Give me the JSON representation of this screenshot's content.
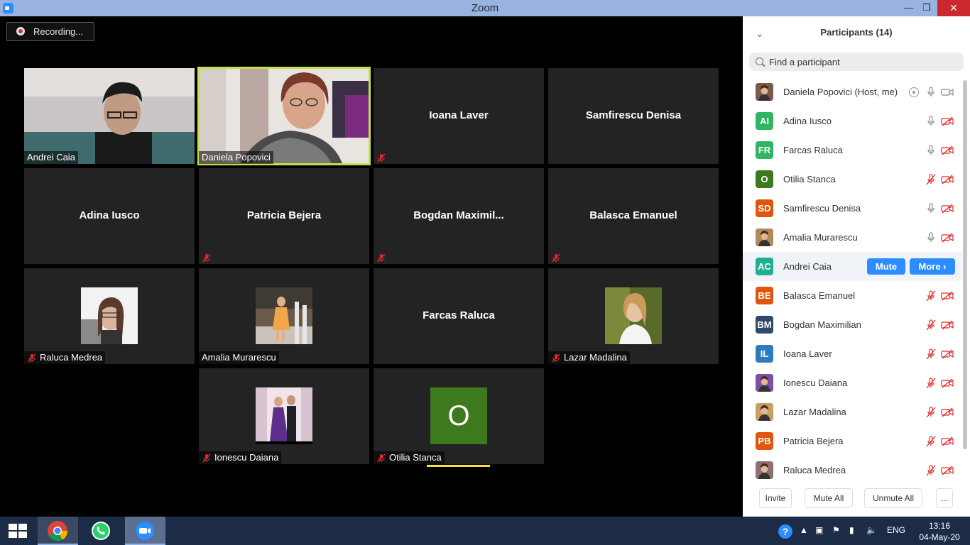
{
  "window": {
    "title": "Zoom"
  },
  "recording": {
    "label": "Recording..."
  },
  "tiles": [
    {
      "id": "andrei",
      "name": "Andrei Caia",
      "muted": false,
      "type": "video"
    },
    {
      "id": "daniela",
      "name": "Daniela Popovici",
      "muted": false,
      "type": "video",
      "active": true
    },
    {
      "id": "ioana",
      "name": "Ioana Laver",
      "muted": true,
      "type": "name"
    },
    {
      "id": "samfirescu",
      "name": "Samfirescu Denisa",
      "muted": false,
      "type": "name"
    },
    {
      "id": "adina",
      "name": "Adina Iusco",
      "muted": false,
      "type": "name"
    },
    {
      "id": "patricia",
      "name": "Patricia Bejera",
      "muted": true,
      "type": "name"
    },
    {
      "id": "bogdan",
      "name": "Bogdan  Maximil...",
      "muted": true,
      "type": "name"
    },
    {
      "id": "balasca",
      "name": "Balasca Emanuel",
      "muted": true,
      "type": "name"
    },
    {
      "id": "raluca",
      "name": "Raluca Medrea",
      "muted": true,
      "type": "photo"
    },
    {
      "id": "amalia",
      "name": "Amalia Murarescu",
      "muted": false,
      "type": "photo"
    },
    {
      "id": "farcas",
      "name": "Farcas Raluca",
      "muted": false,
      "type": "name"
    },
    {
      "id": "lazar",
      "name": "Lazar Madalina",
      "muted": true,
      "type": "photo"
    },
    {
      "id": "ionescu",
      "name": "Ionescu Daiana",
      "muted": true,
      "type": "photo"
    },
    {
      "id": "otilia",
      "name": "Otilia Stanca",
      "muted": true,
      "type": "letter",
      "letter": "O"
    }
  ],
  "panel": {
    "title": "Participants (14)",
    "search_placeholder": "Find a participant",
    "participants": [
      {
        "name": "Daniela Popovici (Host, me)",
        "initials": "",
        "color": "#7a5a4a",
        "mic": "on",
        "cam": "on",
        "photo": true,
        "recording": true
      },
      {
        "name": "Adina Iusco",
        "initials": "AI",
        "color": "#2fb563",
        "mic": "on",
        "cam": "off"
      },
      {
        "name": "Farcas Raluca",
        "initials": "FR",
        "color": "#2fb563",
        "mic": "on",
        "cam": "off"
      },
      {
        "name": "Otilia Stanca",
        "initials": "O",
        "color": "#3d7a1e",
        "mic": "off",
        "cam": "off"
      },
      {
        "name": "Samfirescu Denisa",
        "initials": "SD",
        "color": "#e0560e",
        "mic": "on",
        "cam": "off"
      },
      {
        "name": "Amalia Murarescu",
        "initials": "",
        "color": "#b08a5a",
        "mic": "on",
        "cam": "off",
        "photo": true
      },
      {
        "name": "Andrei Caia",
        "initials": "AC",
        "color": "#20b08f",
        "mic": "none",
        "cam": "none",
        "hover": true
      },
      {
        "name": "Balasca Emanuel",
        "initials": "BE",
        "color": "#e0560e",
        "mic": "off",
        "cam": "off"
      },
      {
        "name": "Bogdan Maximilian",
        "initials": "BM",
        "color": "#2e4a6b",
        "mic": "off",
        "cam": "off"
      },
      {
        "name": "Ioana Laver",
        "initials": "IL",
        "color": "#2d7cc0",
        "mic": "off",
        "cam": "off"
      },
      {
        "name": "Ionescu Daiana",
        "initials": "",
        "color": "#7b4fa3",
        "mic": "off",
        "cam": "off",
        "photo": true
      },
      {
        "name": "Lazar Madalina",
        "initials": "",
        "color": "#c9a060",
        "mic": "off",
        "cam": "off",
        "photo": true
      },
      {
        "name": "Patricia Bejera",
        "initials": "PB",
        "color": "#e0560e",
        "mic": "off",
        "cam": "off"
      },
      {
        "name": "Raluca Medrea",
        "initials": "",
        "color": "#8f7070",
        "mic": "off",
        "cam": "off",
        "photo": true
      }
    ],
    "mute_button": "Mute",
    "more_button": "More",
    "footer": {
      "invite": "Invite",
      "mute_all": "Mute All",
      "unmute_all": "Unmute All",
      "more": "..."
    }
  },
  "taskbar": {
    "language": "ENG",
    "time": "13:16",
    "date": "04-May-20"
  },
  "colors": {
    "accent": "#2d8cff",
    "active_speaker": "#c5e04f",
    "muted_red": "#e02828"
  }
}
